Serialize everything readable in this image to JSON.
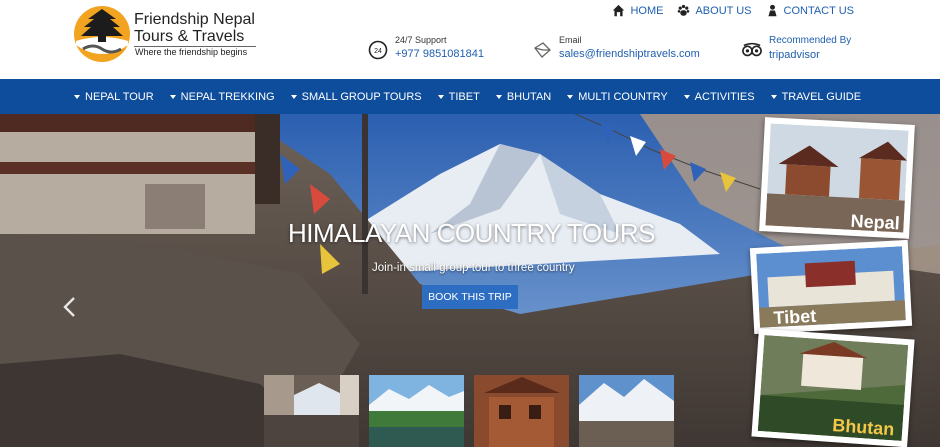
{
  "brand": {
    "line1": "Friendship Nepal",
    "line2": "Tours & Travels",
    "tagline": "Where the friendship begins"
  },
  "topnav": [
    {
      "label": "HOME",
      "icon": "home-icon"
    },
    {
      "label": "ABOUT US",
      "icon": "paw-icon"
    },
    {
      "label": "CONTACT US",
      "icon": "person-icon"
    }
  ],
  "contacts": {
    "support": {
      "label": "24/7 Support",
      "value": "+977 9851081841",
      "icon": "phone-24-icon"
    },
    "email": {
      "label": "Email",
      "value": "sales@friendshiptravels.com",
      "icon": "envelope-icon"
    },
    "recommended": {
      "label": "Recommended By",
      "value": "tripadvisor",
      "icon": "tripadvisor-owl-icon"
    }
  },
  "mainnav": [
    "NEPAL TOUR",
    "NEPAL TREKKING",
    "SMALL GROUP TOURS",
    "TIBET",
    "BHUTAN",
    "MULTI COUNTRY",
    "ACTIVITIES",
    "TRAVEL GUIDE"
  ],
  "hero": {
    "title": "HIMALAYAN COUNTRY TOURS",
    "subtitle": "Join-in small group tour to three country",
    "button": "BOOK THIS TRIP"
  },
  "polaroids": {
    "nepal": "Nepal",
    "tibet": "Tibet",
    "bhutan": "Bhutan"
  },
  "colors": {
    "nav_bg": "#0e4d9b",
    "link": "#1f5fae",
    "button": "#2d6ec3"
  }
}
